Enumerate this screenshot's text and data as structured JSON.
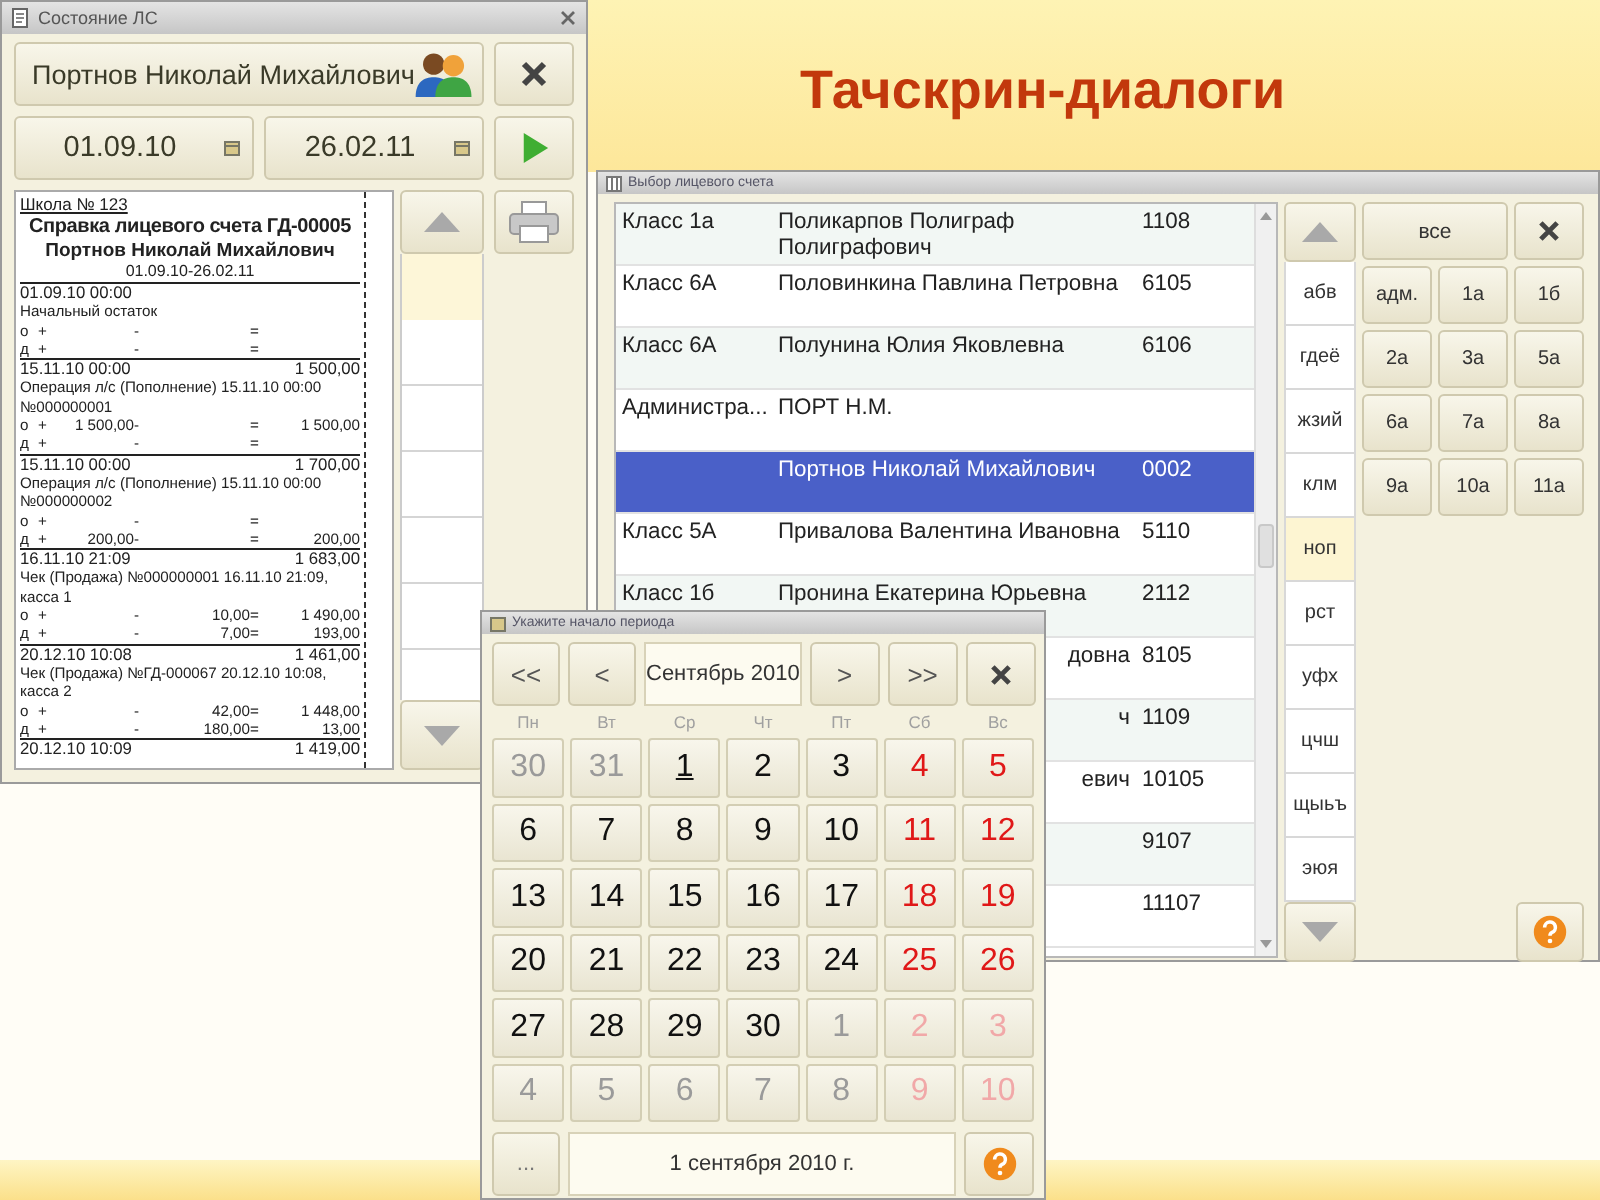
{
  "slide": {
    "title": "Тачскрин-диалоги"
  },
  "account_window": {
    "title": "Состояние ЛС",
    "person": "Портнов Николай Михайлович",
    "date_from": "01.09.10",
    "date_to": "26.02.11",
    "report": {
      "school": "Школа № 123",
      "heading": "Справка лицевого счета ГД-00005",
      "person": "Портнов Николай Михайлович",
      "period": "01.09.10-26.02.11",
      "blocks": [
        {
          "datetime": "01.09.10 00:00",
          "description": "Начальный остаток",
          "rows": [
            {
              "mark": "о",
              "plus": "+",
              "minus": "-",
              "eq": "="
            },
            {
              "mark": "д",
              "plus": "+",
              "minus": "-",
              "eq": "="
            }
          ]
        },
        {
          "datetime": "15.11.10 00:00",
          "balance": "1 500,00",
          "description": "Операция л/с (Пополнение) 15.11.10 00:00 №000000001",
          "rows": [
            {
              "mark": "о",
              "plus": "+",
              "in": "1 500,00",
              "minus": "-",
              "eq": "=",
              "total": "1 500,00"
            },
            {
              "mark": "д",
              "plus": "+",
              "minus": "-",
              "eq": "="
            }
          ]
        },
        {
          "datetime": "15.11.10 00:00",
          "balance": "1 700,00",
          "description": "Операция л/с (Пополнение) 15.11.10 00:00 №000000002",
          "rows": [
            {
              "mark": "о",
              "plus": "+",
              "minus": "-",
              "eq": "="
            },
            {
              "mark": "д",
              "plus": "+",
              "in": "200,00",
              "minus": "-",
              "eq": "=",
              "total": "200,00"
            }
          ]
        },
        {
          "datetime": "16.11.10 21:09",
          "balance": "1 683,00",
          "description": "Чек (Продажа) №000000001 16.11.10 21:09, касса 1",
          "rows": [
            {
              "mark": "о",
              "plus": "+",
              "minus": "-",
              "out": "10,00",
              "eq": "=",
              "total": "1 490,00"
            },
            {
              "mark": "д",
              "plus": "+",
              "minus": "-",
              "out": "7,00",
              "eq": "=",
              "total": "193,00"
            }
          ]
        },
        {
          "datetime": "20.12.10 10:08",
          "balance": "1 461,00",
          "description": "Чек (Продажа) №ГД-000067 20.12.10 10:08, касса 2",
          "rows": [
            {
              "mark": "о",
              "plus": "+",
              "minus": "-",
              "out": "42,00",
              "eq": "=",
              "total": "1 448,00"
            },
            {
              "mark": "д",
              "plus": "+",
              "minus": "-",
              "out": "180,00",
              "eq": "=",
              "total": "13,00"
            }
          ]
        },
        {
          "datetime": "20.12.10 10:09",
          "balance": "1 419,00"
        }
      ]
    }
  },
  "select_window": {
    "title": "Выбор лицевого счета",
    "rows": [
      {
        "class": "Класс 1а",
        "name": "Поликарпов Полиграф Полиграфович",
        "number": "1108",
        "selected": false
      },
      {
        "class": "Класс 6А",
        "name": "Половинкина Павлина Петровна",
        "number": "6105",
        "selected": false
      },
      {
        "class": "Класс 6А",
        "name": "Полунина Юлия Яковлевна",
        "number": "6106",
        "selected": false
      },
      {
        "class": "Администра...",
        "name": "ПОРТ Н.М.",
        "selected": false
      },
      {
        "name": "Портнов Николай Михайлович",
        "number": "0002",
        "selected": true
      },
      {
        "class": "Класс 5А",
        "name": "Привалова Валентина Ивановна",
        "number": "5110",
        "selected": false
      },
      {
        "class": "Класс 1б",
        "name": "Пронина Екатерина Юрьевна",
        "number": "2112",
        "selected": false
      },
      {
        "name_end": "довна",
        "number": "8105",
        "selected": false
      },
      {
        "name_end": "ч",
        "number": "1109",
        "selected": false
      },
      {
        "name_end": "евич",
        "number": "10105",
        "selected": false
      },
      {
        "number": "9107",
        "selected": false
      },
      {
        "number": "11107",
        "selected": false
      }
    ],
    "letters": [
      {
        "label": "абв",
        "selected": false
      },
      {
        "label": "гдеё",
        "selected": false
      },
      {
        "label": "жзий",
        "selected": false
      },
      {
        "label": "клм",
        "selected": false
      },
      {
        "label": "ноп",
        "selected": true
      },
      {
        "label": "рст",
        "selected": false
      },
      {
        "label": "уфх",
        "selected": false
      },
      {
        "label": "цчш",
        "selected": false
      },
      {
        "label": "щыьъ",
        "selected": false
      },
      {
        "label": "эюя",
        "selected": false
      }
    ],
    "all_button": "все",
    "classes": [
      "адм.",
      "1а",
      "1б",
      "2а",
      "3а",
      "5а",
      "6а",
      "7а",
      "8а",
      "9а",
      "10а",
      "11а"
    ]
  },
  "calendar": {
    "title": "Укажите начало периода",
    "prev_year": "<<",
    "prev_month": "<",
    "month": "Сентябрь 2010",
    "next_month": ">",
    "next_year": ">>",
    "weekdays": [
      {
        "label": "Пн",
        "weekend": false
      },
      {
        "label": "Вт",
        "weekend": false
      },
      {
        "label": "Ср",
        "weekend": false
      },
      {
        "label": "Чт",
        "weekend": false
      },
      {
        "label": "Пт",
        "weekend": false
      },
      {
        "label": "Сб",
        "weekend": true
      },
      {
        "label": "Вс",
        "weekend": true
      }
    ],
    "weeks": [
      [
        {
          "label": "30",
          "other_month": true,
          "selected": false
        },
        {
          "label": "31",
          "other_month": true,
          "selected": false
        },
        {
          "label": "1",
          "other_month": false,
          "selected": true
        },
        {
          "label": "2",
          "other_month": false,
          "selected": false
        },
        {
          "label": "3",
          "other_month": false,
          "selected": false
        },
        {
          "label": "4",
          "other_month": false,
          "selected": false
        },
        {
          "label": "5",
          "other_month": false,
          "selected": false
        }
      ],
      [
        {
          "label": "6",
          "other_month": false,
          "selected": false
        },
        {
          "label": "7",
          "other_month": false,
          "selected": false
        },
        {
          "label": "8",
          "other_month": false,
          "selected": false
        },
        {
          "label": "9",
          "other_month": false,
          "selected": false
        },
        {
          "label": "10",
          "other_month": false,
          "selected": false
        },
        {
          "label": "11",
          "other_month": false,
          "selected": false
        },
        {
          "label": "12",
          "other_month": false,
          "selected": false
        }
      ],
      [
        {
          "label": "13",
          "other_month": false,
          "selected": false
        },
        {
          "label": "14",
          "other_month": false,
          "selected": false
        },
        {
          "label": "15",
          "other_month": false,
          "selected": false
        },
        {
          "label": "16",
          "other_month": false,
          "selected": false
        },
        {
          "label": "17",
          "other_month": false,
          "selected": false
        },
        {
          "label": "18",
          "other_month": false,
          "selected": false
        },
        {
          "label": "19",
          "other_month": false,
          "selected": false
        }
      ],
      [
        {
          "label": "20",
          "other_month": false,
          "selected": false
        },
        {
          "label": "21",
          "other_month": false,
          "selected": false
        },
        {
          "label": "22",
          "other_month": false,
          "selected": false
        },
        {
          "label": "23",
          "other_month": false,
          "selected": false
        },
        {
          "label": "24",
          "other_month": false,
          "selected": false
        },
        {
          "label": "25",
          "other_month": false,
          "selected": false
        },
        {
          "label": "26",
          "other_month": false,
          "selected": false
        }
      ],
      [
        {
          "label": "27",
          "other_month": false,
          "selected": false
        },
        {
          "label": "28",
          "other_month": false,
          "selected": false
        },
        {
          "label": "29",
          "other_month": false,
          "selected": false
        },
        {
          "label": "30",
          "other_month": false,
          "selected": false
        },
        {
          "label": "1",
          "other_month": true,
          "selected": false
        },
        {
          "label": "2",
          "other_month": true,
          "selected": false
        },
        {
          "label": "3",
          "other_month": true,
          "selected": false
        }
      ],
      [
        {
          "label": "4",
          "other_month": true,
          "selected": false
        },
        {
          "label": "5",
          "other_month": true,
          "selected": false
        },
        {
          "label": "6",
          "other_month": true,
          "selected": false
        },
        {
          "label": "7",
          "other_month": true,
          "selected": false
        },
        {
          "label": "8",
          "other_month": true,
          "selected": false
        },
        {
          "label": "9",
          "other_month": true,
          "selected": false
        },
        {
          "label": "10",
          "other_month": true,
          "selected": false
        }
      ]
    ],
    "more_button": "...",
    "date_value": "1 сентября 2010 г."
  }
}
